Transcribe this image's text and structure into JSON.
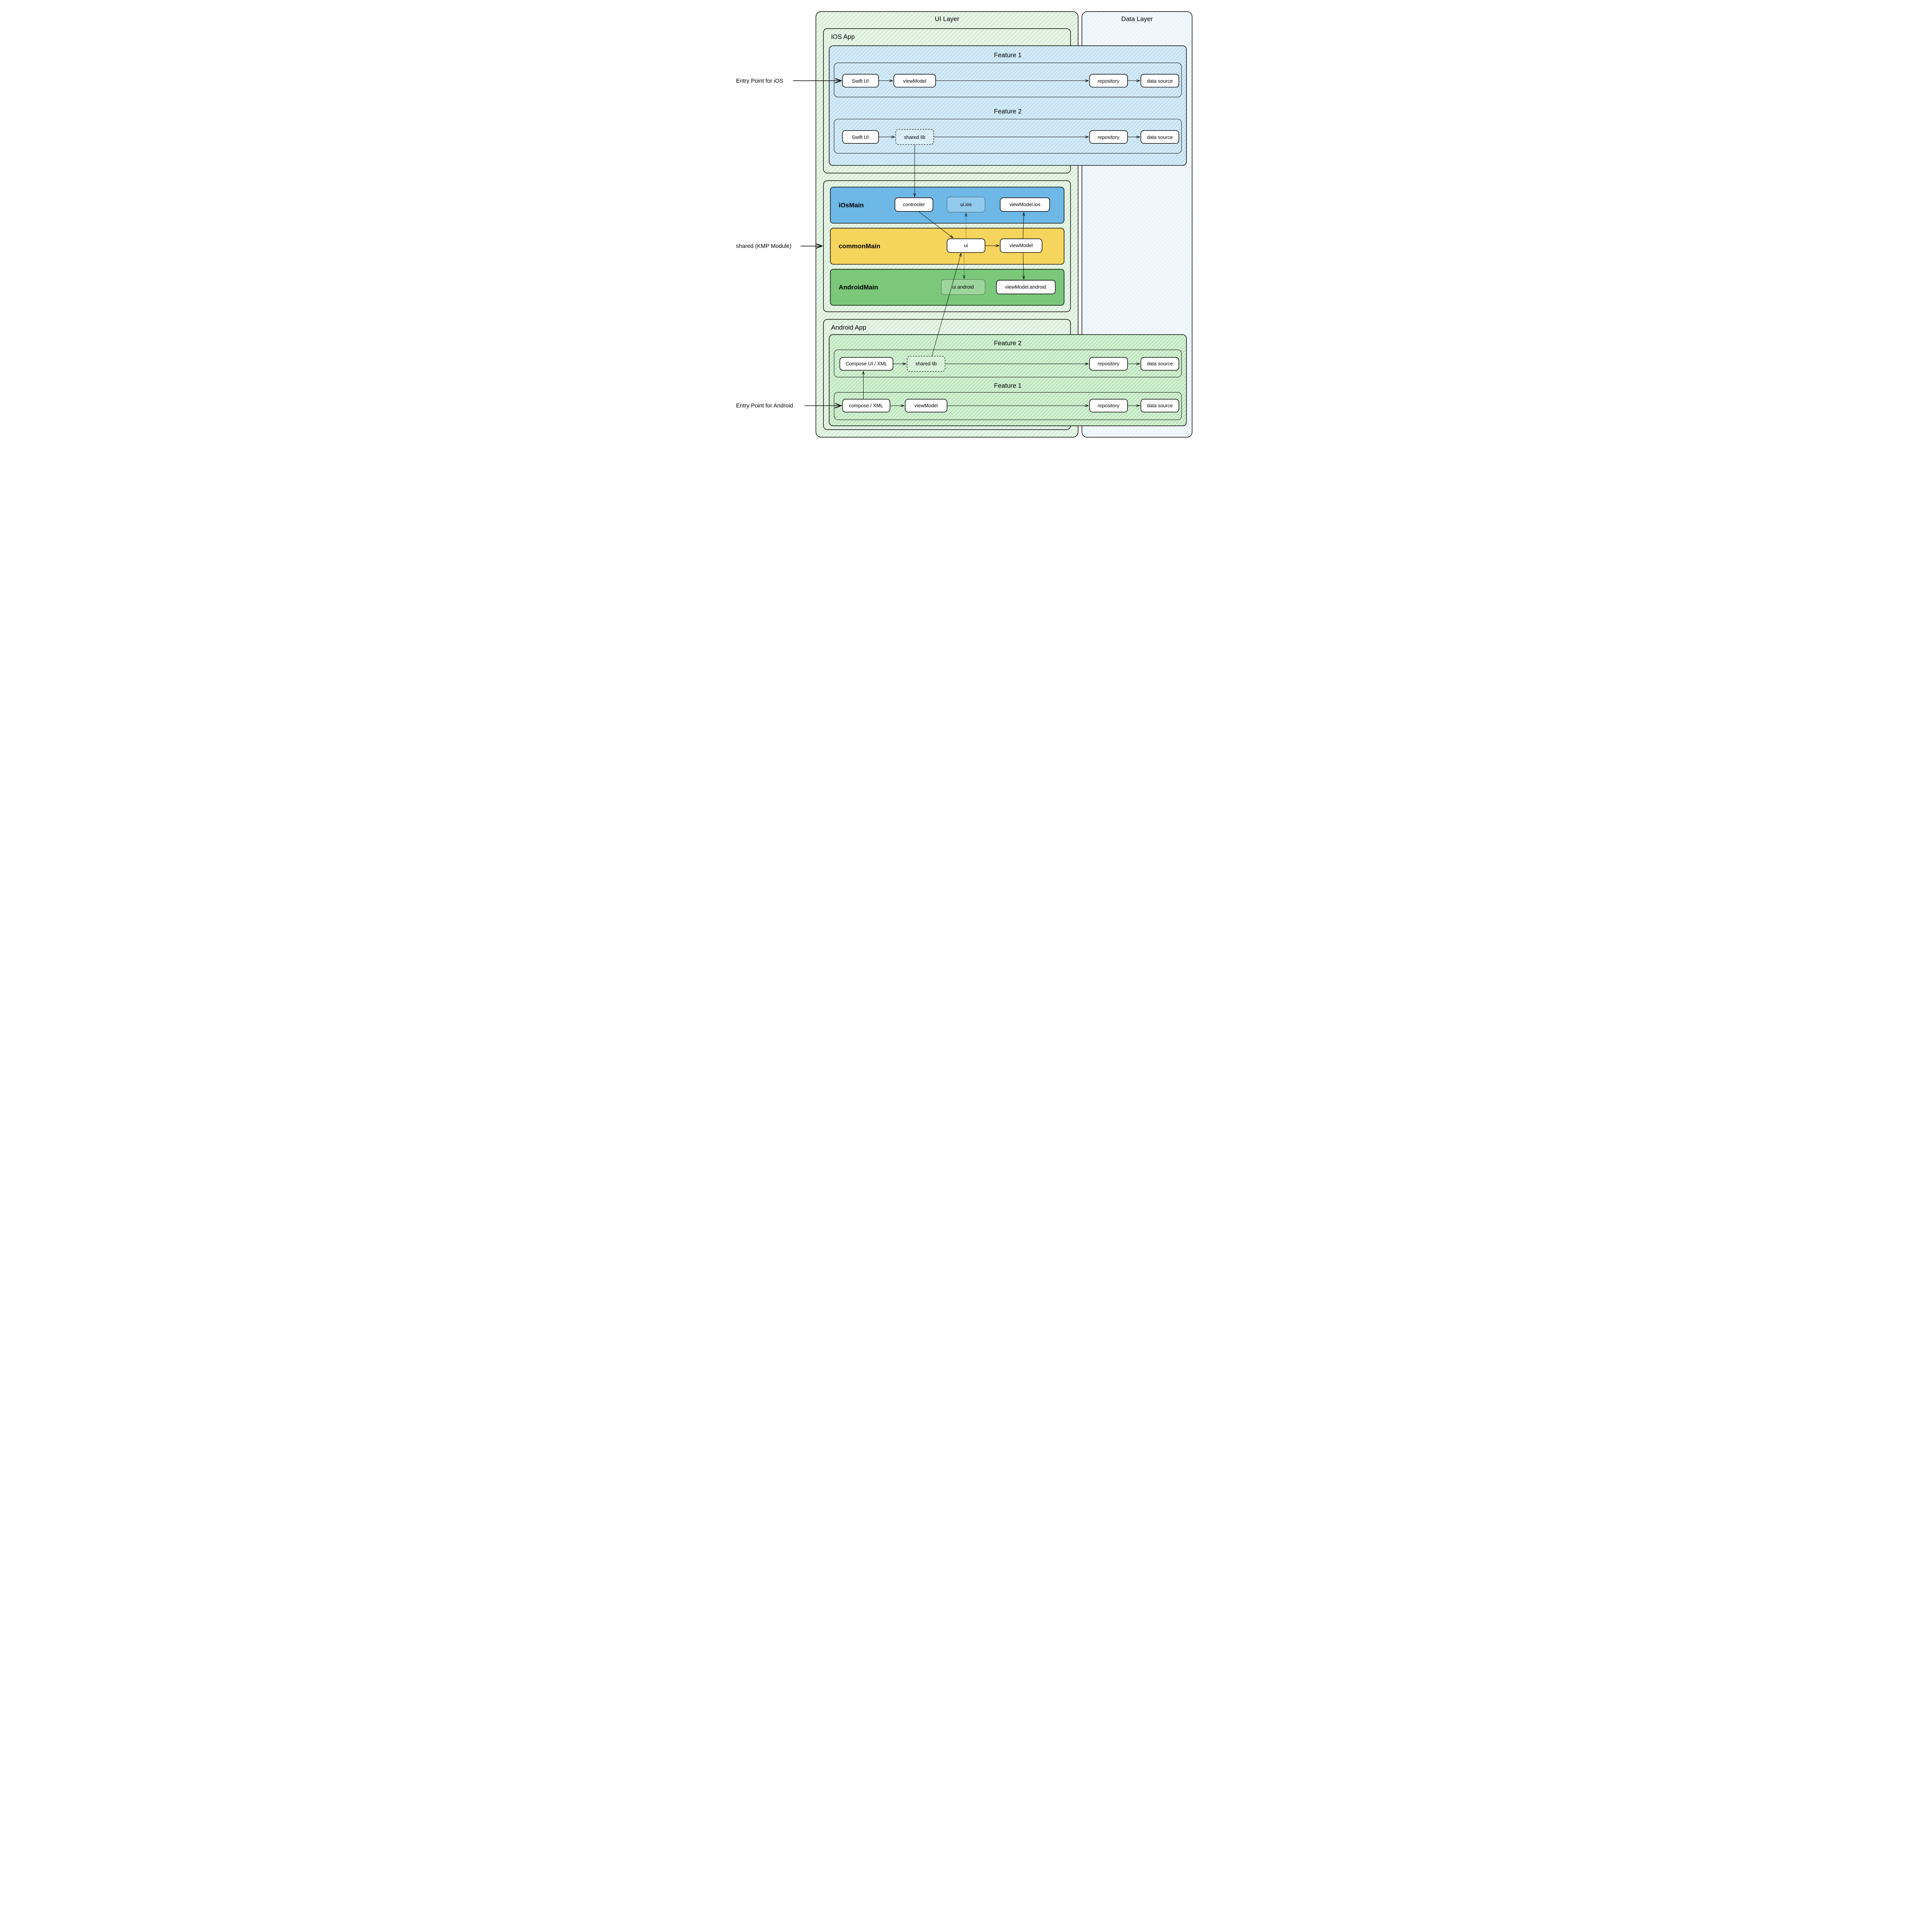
{
  "layers": {
    "ui": "UI Layer",
    "data": "Data Layer"
  },
  "ios_app": {
    "title": "iOS App",
    "feature1": {
      "title": "Feature 1",
      "n1": "Swift UI",
      "n2": "viewModel",
      "n3": "repository",
      "n4": "data source"
    },
    "feature2": {
      "title": "Feature 2",
      "n1": "Swift UI",
      "n2": "shared lib",
      "n3": "repository",
      "n4": "data source"
    }
  },
  "shared": {
    "iosMain": {
      "title": "iOsMain",
      "n1": "controoler",
      "n2": "ui.ios",
      "n3": "viewModel.ios"
    },
    "commonMain": {
      "title": "commonMain",
      "n1": "ui",
      "n2": "viewModel"
    },
    "androidMain": {
      "title": "AndroidMain",
      "n1": "ui.android",
      "n2": "viewModel.android"
    }
  },
  "android_app": {
    "title": "Android App",
    "feature2": {
      "title": "Feature 2",
      "n1": "Compose UI / XML",
      "n2": "shared lib",
      "n3": "repository",
      "n4": "data source"
    },
    "feature1": {
      "title": "Feature 1",
      "n1": "compose / XML",
      "n2": "viewModel",
      "n3": "repository",
      "n4": "data source"
    }
  },
  "external": {
    "ios_entry": "Entry Point for iOS",
    "shared_kmp": "shared (KMP Module)",
    "android_entry": "Entry Point for Android"
  }
}
